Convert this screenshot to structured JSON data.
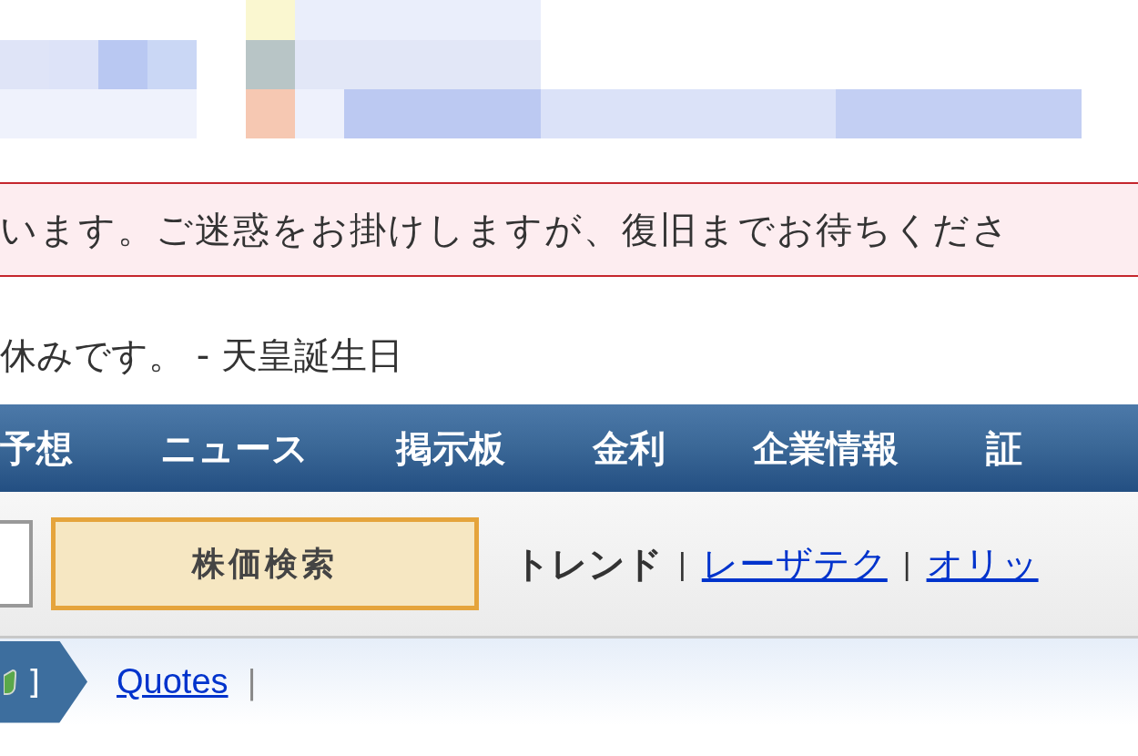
{
  "notice": {
    "text": "います。ご迷惑をお掛けしますが、復旧までお待ちくださ"
  },
  "holiday": {
    "text": "休みです。 - 天皇誕生日"
  },
  "nav": {
    "items": [
      {
        "label": "予想"
      },
      {
        "label": "ニュース"
      },
      {
        "label": "掲示板"
      },
      {
        "label": "金利"
      },
      {
        "label": "企業情報"
      },
      {
        "label": "証"
      }
    ]
  },
  "search": {
    "button": "株価検索"
  },
  "trends": [
    {
      "kind": "label",
      "text": "トレンド"
    },
    {
      "kind": "separator",
      "text": "|"
    },
    {
      "kind": "link",
      "text": "レーザテク"
    },
    {
      "kind": "separator",
      "text": "|"
    },
    {
      "kind": "link",
      "text": "オリッ"
    }
  ],
  "breadcrumb": {
    "tag": "]",
    "items": [
      {
        "kind": "link",
        "text": "Quotes"
      },
      {
        "kind": "separator",
        "text": "|"
      }
    ]
  }
}
